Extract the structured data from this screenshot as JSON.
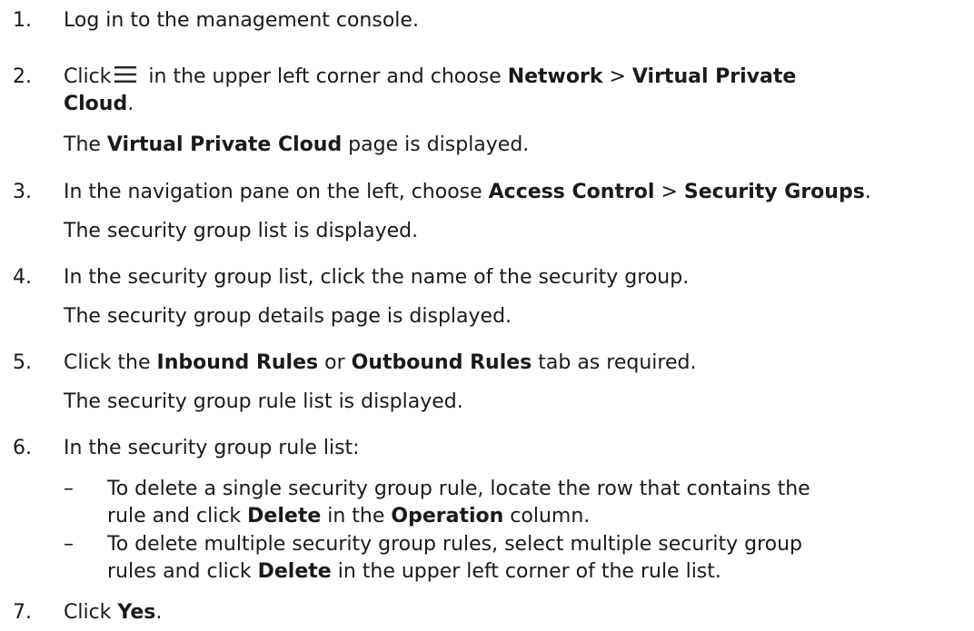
{
  "steps": [
    {
      "number": "1.",
      "text": "Log in to the management console."
    },
    {
      "number": "2.",
      "pre": "Click",
      "icon": "menu-icon",
      "mid": " in the upper left corner and choose ",
      "b1": "Network",
      "sep": " > ",
      "b2a": "Virtual Private",
      "b2b": "Cloud",
      "end": ".",
      "note_pre": "The ",
      "note_bold": "Virtual Private Cloud",
      "note_post": " page is displayed."
    },
    {
      "number": "3.",
      "pre": "In the navigation pane on the left, choose ",
      "b1": "Access Control",
      "sep": " > ",
      "b2": "Security Groups",
      "end": ".",
      "note": "The security group list is displayed."
    },
    {
      "number": "4.",
      "text": "In the security group list, click the name of the security group.",
      "note": "The security group details page is displayed."
    },
    {
      "number": "5.",
      "pre": "Click the ",
      "b1": "Inbound Rules",
      "mid": " or ",
      "b2": "Outbound Rules",
      "end": " tab as required.",
      "note": "The security group rule list is displayed."
    },
    {
      "number": "6.",
      "text": "In the security group rule list:",
      "bullets": [
        {
          "dash": "–",
          "line1": "To delete a single security group rule, locate the row that contains the",
          "l2_pre": "rule and click ",
          "l2_b1": "Delete",
          "l2_mid": " in the ",
          "l2_b2": "Operation",
          "l2_end": " column."
        },
        {
          "dash": "–",
          "line1": "To delete multiple security group rules, select multiple security group",
          "l2_pre": "rules and click ",
          "l2_b1": "Delete",
          "l2_end": " in the upper left corner of the rule list."
        }
      ]
    },
    {
      "number": "7.",
      "pre": "Click ",
      "b1": "Yes",
      "end": "."
    }
  ]
}
